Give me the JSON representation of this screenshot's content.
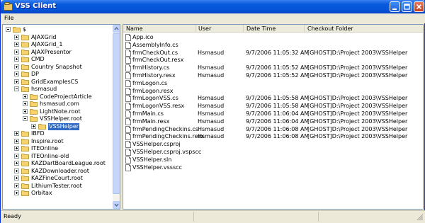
{
  "window": {
    "title": "VSS Client"
  },
  "menu": {
    "file": "File"
  },
  "tree": {
    "items": [
      {
        "label": "$",
        "expanded": true
      },
      {
        "label": "AJAXGrid"
      },
      {
        "label": "AJAXGrid_1"
      },
      {
        "label": "AJAXPresentor"
      },
      {
        "label": "CMD"
      },
      {
        "label": "Country Snapshot"
      },
      {
        "label": "DP"
      },
      {
        "label": "GridExamplesCS"
      },
      {
        "label": "hsmasud",
        "expanded": true
      },
      {
        "label": "CodeProjectArticle"
      },
      {
        "label": "hsmasud.com"
      },
      {
        "label": "LightNote.root"
      },
      {
        "label": "VSSHelper.root",
        "expanded": true
      },
      {
        "label": "VSSHelper",
        "selected": true
      },
      {
        "label": "IBFD"
      },
      {
        "label": "Inspire.root"
      },
      {
        "label": "ITEOnline"
      },
      {
        "label": "ITEOnline-old"
      },
      {
        "label": "KAZDartBoardLeague.root"
      },
      {
        "label": "KAZDownloader.root"
      },
      {
        "label": "KAZFineCourt.root"
      },
      {
        "label": "LithiumTester.root"
      },
      {
        "label": "Orbitax"
      }
    ]
  },
  "list": {
    "headers": {
      "name": "Name",
      "user": "User",
      "datetime": "Date Time",
      "folder": "Checkout Folder"
    },
    "rows": [
      {
        "name": "App.ico",
        "user": "",
        "datetime": "",
        "folder": ""
      },
      {
        "name": "AssemblyInfo.cs",
        "user": "",
        "datetime": "",
        "folder": ""
      },
      {
        "name": "frmCheckOut.cs",
        "user": "Hsmasud",
        "datetime": "9/7/2006 11:05:32 AM",
        "folder": "[GHOST]D:\\Project 2003\\VSSHelper"
      },
      {
        "name": "frmCheckOut.resx",
        "user": "",
        "datetime": "",
        "folder": ""
      },
      {
        "name": "frmHistory.cs",
        "user": "Hsmasud",
        "datetime": "9/7/2006 11:05:52 AM",
        "folder": "[GHOST]D:\\Project 2003\\VSSHelper"
      },
      {
        "name": "frmHistory.resx",
        "user": "Hsmasud",
        "datetime": "9/7/2006 11:05:52 AM",
        "folder": "[GHOST]D:\\Project 2003\\VSSHelper"
      },
      {
        "name": "frmLogon.cs",
        "user": "",
        "datetime": "",
        "folder": ""
      },
      {
        "name": "frmLogon.resx",
        "user": "",
        "datetime": "",
        "folder": ""
      },
      {
        "name": "frmLogonVSS.cs",
        "user": "Hsmasud",
        "datetime": "9/7/2006 11:05:58 AM",
        "folder": "[GHOST]D:\\Project 2003\\VSSHelper"
      },
      {
        "name": "frmLogonVSS.resx",
        "user": "Hsmasud",
        "datetime": "9/7/2006 11:05:58 AM",
        "folder": "[GHOST]D:\\Project 2003\\VSSHelper"
      },
      {
        "name": "frmMain.cs",
        "user": "Hsmasud",
        "datetime": "9/7/2006 11:06:04 AM",
        "folder": "[GHOST]D:\\Project 2003\\VSSHelper"
      },
      {
        "name": "frmMain.resx",
        "user": "Hsmasud",
        "datetime": "9/7/2006 11:06:04 AM",
        "folder": "[GHOST]D:\\Project 2003\\VSSHelper"
      },
      {
        "name": "frmPendingCheckins.cs",
        "user": "Hsmasud",
        "datetime": "9/7/2006 11:06:08 AM",
        "folder": "[GHOST]D:\\Project 2003\\VSSHelper"
      },
      {
        "name": "frmPendingCheckins.resx",
        "user": "Hsmasud",
        "datetime": "9/7/2006 11:06:08 AM",
        "folder": "[GHOST]D:\\Project 2003\\VSSHelper"
      },
      {
        "name": "VSSHelper.csproj",
        "user": "",
        "datetime": "",
        "folder": ""
      },
      {
        "name": "VSSHelper.csproj.vspscc",
        "user": "",
        "datetime": "",
        "folder": ""
      },
      {
        "name": "VSSHelper.sln",
        "user": "",
        "datetime": "",
        "folder": ""
      },
      {
        "name": "VSSHelper.vssscc",
        "user": "",
        "datetime": "",
        "folder": ""
      }
    ]
  },
  "status": {
    "text": "Ready"
  },
  "colors": {
    "titlebar": "#0654d9",
    "selection": "#316ac5",
    "folder": "#f6d36d"
  }
}
